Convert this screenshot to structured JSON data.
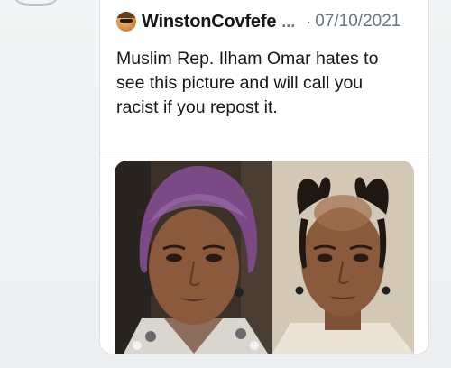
{
  "tweet": {
    "username": "WinstonCovfefe",
    "ellipsis": "...",
    "separator": "·",
    "date": "07/10/2021",
    "text_lines": [
      "Muslim Rep. Ilham Omar hates to",
      "see this picture and will call you",
      "racist if you repost it."
    ]
  },
  "media": {
    "left_photo": "woman-in-purple-headscarf",
    "right_photo": "woman-with-thinning-hair-edited"
  },
  "colors": {
    "text_primary": "#14171a",
    "text_secondary": "#657786",
    "headscarf_purple": "#7b4a86",
    "card_background": "#ffffff",
    "page_background": "#eef0f2"
  }
}
